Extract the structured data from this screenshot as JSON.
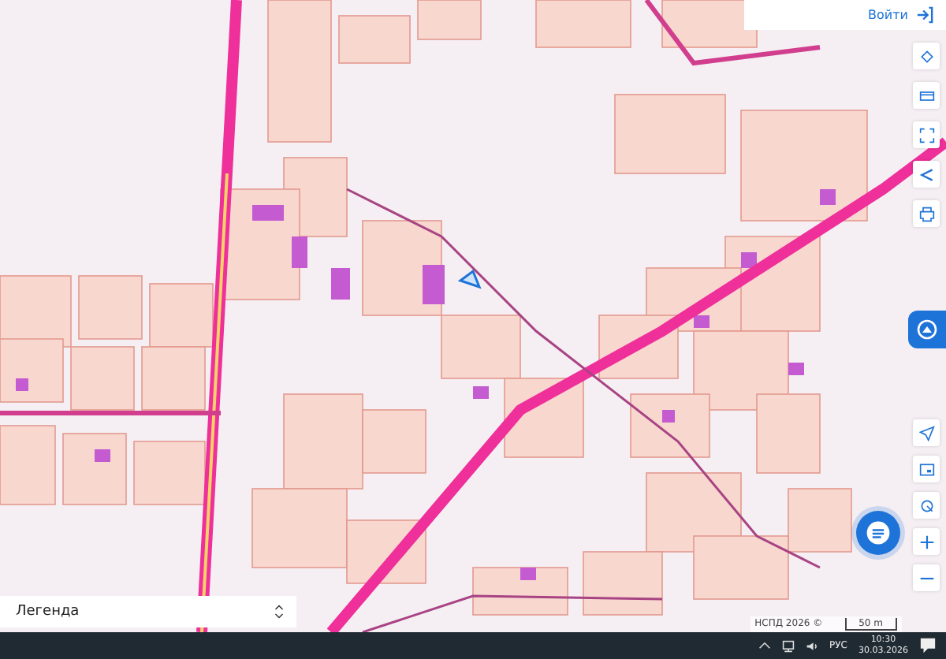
{
  "header": {
    "login_button": "Войти"
  },
  "legend": {
    "label": "Легенда"
  },
  "map": {
    "attribution": "НСПД 2026 ©",
    "scale": "50 m"
  },
  "taskbar": {
    "language": "РУС",
    "time": "10:30",
    "date": "30.03.2026"
  }
}
